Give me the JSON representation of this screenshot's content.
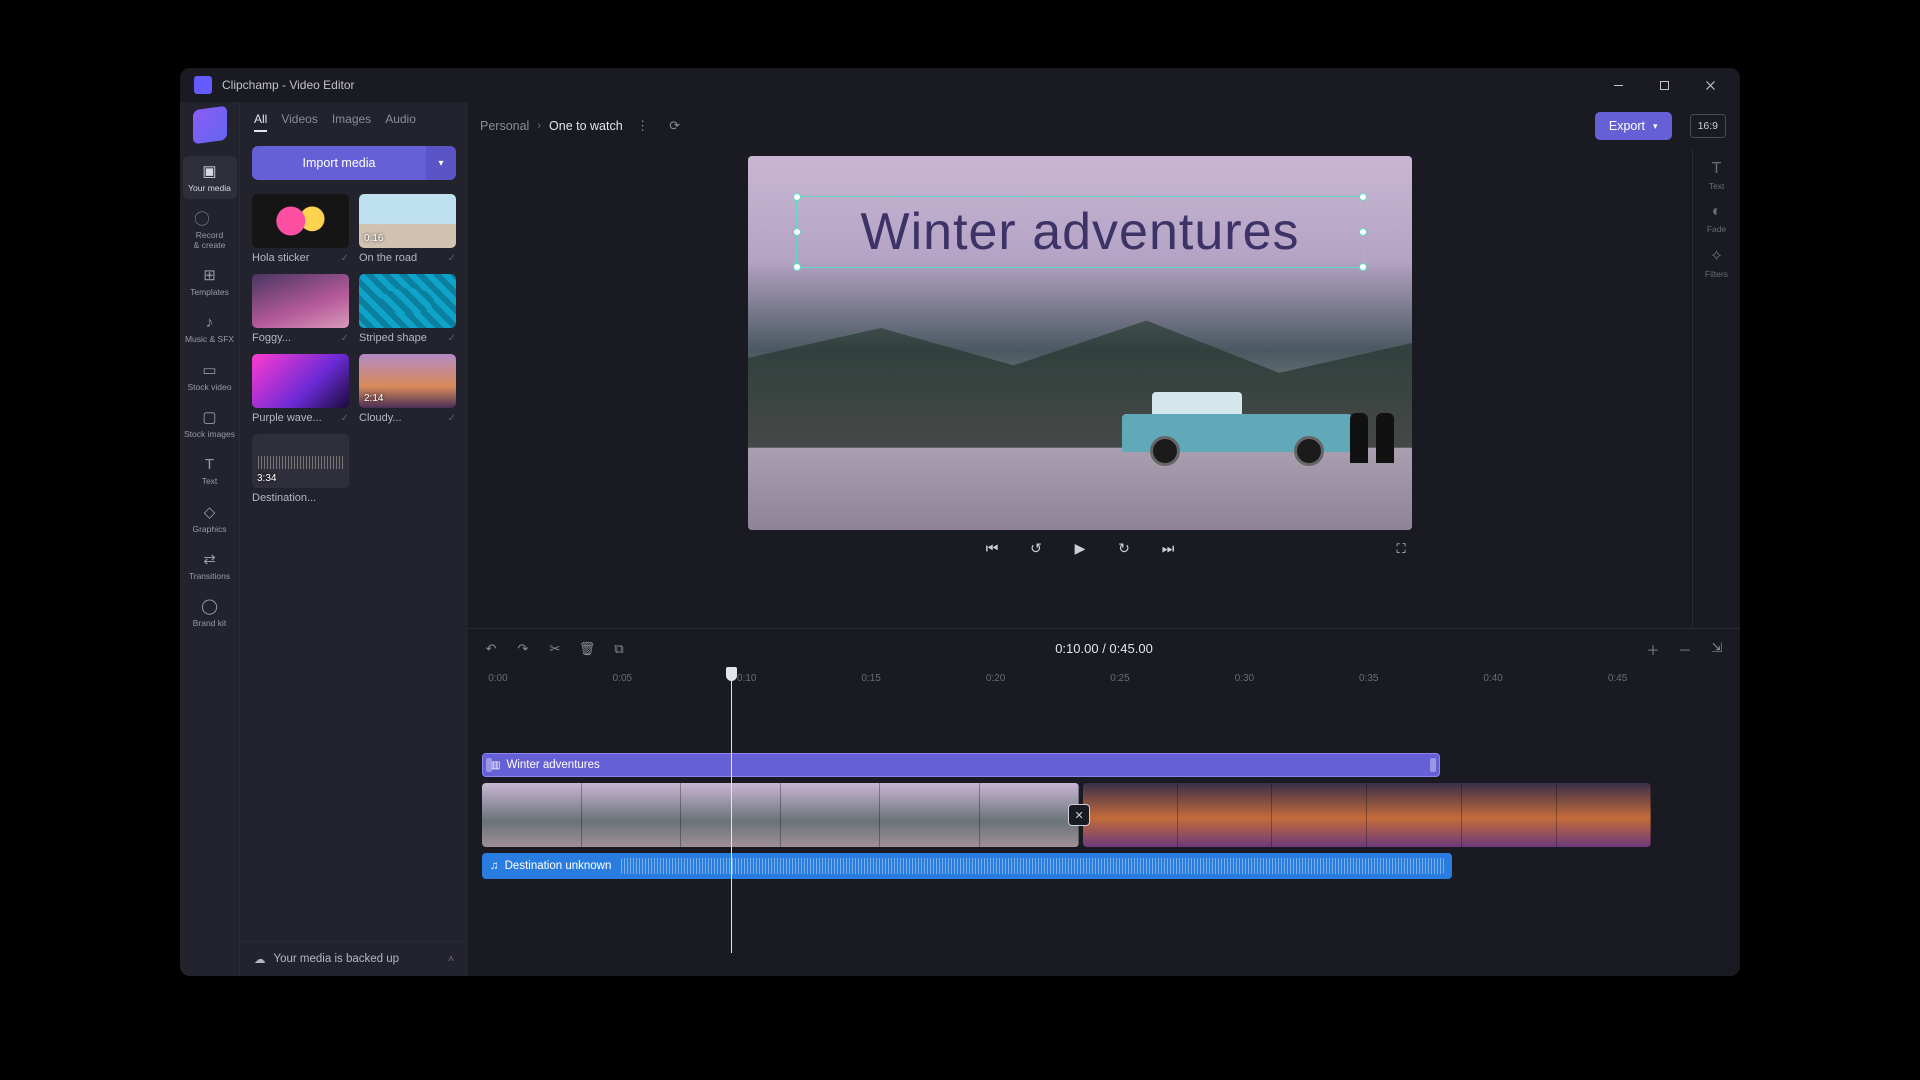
{
  "window": {
    "title": "Clipchamp - Video Editor"
  },
  "rail": {
    "items": [
      {
        "label": "Your media"
      },
      {
        "label": "Record\n& create"
      },
      {
        "label": "Templates"
      },
      {
        "label": "Music & SFX"
      },
      {
        "label": "Stock video"
      },
      {
        "label": "Stock images"
      },
      {
        "label": "Text"
      },
      {
        "label": "Graphics"
      },
      {
        "label": "Transitions"
      },
      {
        "label": "Brand kit"
      }
    ]
  },
  "media": {
    "tabs": [
      "All",
      "Videos",
      "Images",
      "Audio"
    ],
    "import_label": "Import media",
    "items": [
      {
        "name": "Hola sticker",
        "dur": ""
      },
      {
        "name": "On the road",
        "dur": "0:16"
      },
      {
        "name": "Foggy...",
        "dur": ""
      },
      {
        "name": "Striped shape",
        "dur": ""
      },
      {
        "name": "Purple wave...",
        "dur": ""
      },
      {
        "name": "Cloudy...",
        "dur": "2:14"
      },
      {
        "name": "Destination...",
        "dur": "3:34"
      }
    ],
    "backup": "Your media is backed up"
  },
  "header": {
    "crumb_root": "Personal",
    "crumb_current": "One to watch",
    "export": "Export",
    "aspect": "16:9"
  },
  "right_rail": {
    "items": [
      {
        "label": "Text"
      },
      {
        "label": "Fade"
      },
      {
        "label": "Filters"
      }
    ]
  },
  "canvas": {
    "title_text": "Winter adventures"
  },
  "playback": {
    "current": "0:10.00",
    "sep": " / ",
    "total": "0:45.00"
  },
  "ruler": [
    "0:00",
    "0:05",
    "0:10",
    "0:15",
    "0:20",
    "0:25",
    "0:30",
    "0:35",
    "0:40",
    "0:45"
  ],
  "timeline": {
    "text_clip": "Winter adventures",
    "audio_clip": "Destination unknown"
  }
}
